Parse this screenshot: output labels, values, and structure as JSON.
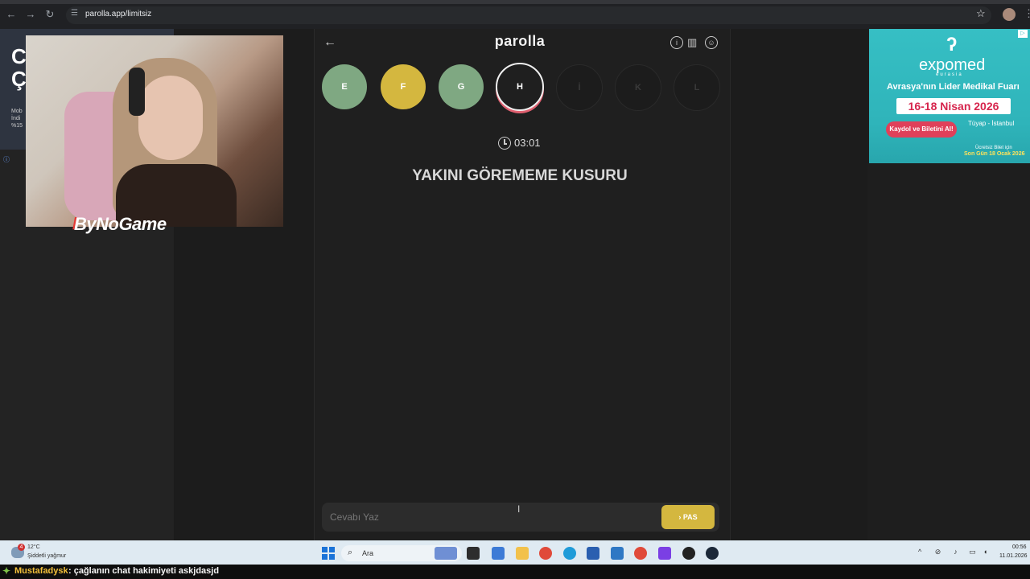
{
  "browser": {
    "url": "parolla.app/limitsiz"
  },
  "left_ad": {
    "title_lines": "C\nÇ",
    "small_text": "Mob\nİndi\n%15"
  },
  "overlay": {
    "brand": "ByNoGame"
  },
  "game": {
    "title": "parolla",
    "letters": [
      {
        "label": "E",
        "state": "correct",
        "color": "#7fa882"
      },
      {
        "label": "F",
        "state": "passed",
        "color": "#d4b73f"
      },
      {
        "label": "G",
        "state": "correct",
        "color": "#7fa882"
      },
      {
        "label": "H",
        "state": "current"
      },
      {
        "label": "İ",
        "state": "upcoming"
      },
      {
        "label": "K",
        "state": "upcoming"
      },
      {
        "label": "L",
        "state": "upcoming"
      }
    ],
    "timer": "03:01",
    "question": "YAKINI GÖREMEME KUSURU",
    "answer_placeholder": "Cevabı Yaz",
    "pass_label": "PAS",
    "icons": [
      "back-arrow-icon",
      "info-icon",
      "stats-icon",
      "user-icon",
      "clock-icon",
      "chevron-right-icon"
    ]
  },
  "right_ad": {
    "brand": "expomed",
    "sub": "eurasia",
    "headline": "Avrasya'nın Lider Medikal Fuarı",
    "dates": "16-18 Nisan 2026",
    "cta": "Kaydol ve Biletini Al!",
    "venue": "Tüyap - İstanbul",
    "note": "Ücretsiz Bilet için",
    "deadline": "Son Gün 18 Ocak 2026"
  },
  "taskbar": {
    "weather_badge": "4",
    "temperature": "12°C",
    "weather_desc": "Şiddetli yağmur",
    "search_label": "Ara",
    "time": "00:56",
    "date": "11.01.2026"
  },
  "chat": {
    "username": "Mustafadysk",
    "message": ": çağlanın chat hakimiyeti askjdasjd"
  },
  "colors": {
    "correct": "#7fa882",
    "passed": "#d4b73f",
    "current_ring": "#e06070",
    "ad_teal": "#36bfc4",
    "chat_user": "#f3c03a"
  }
}
